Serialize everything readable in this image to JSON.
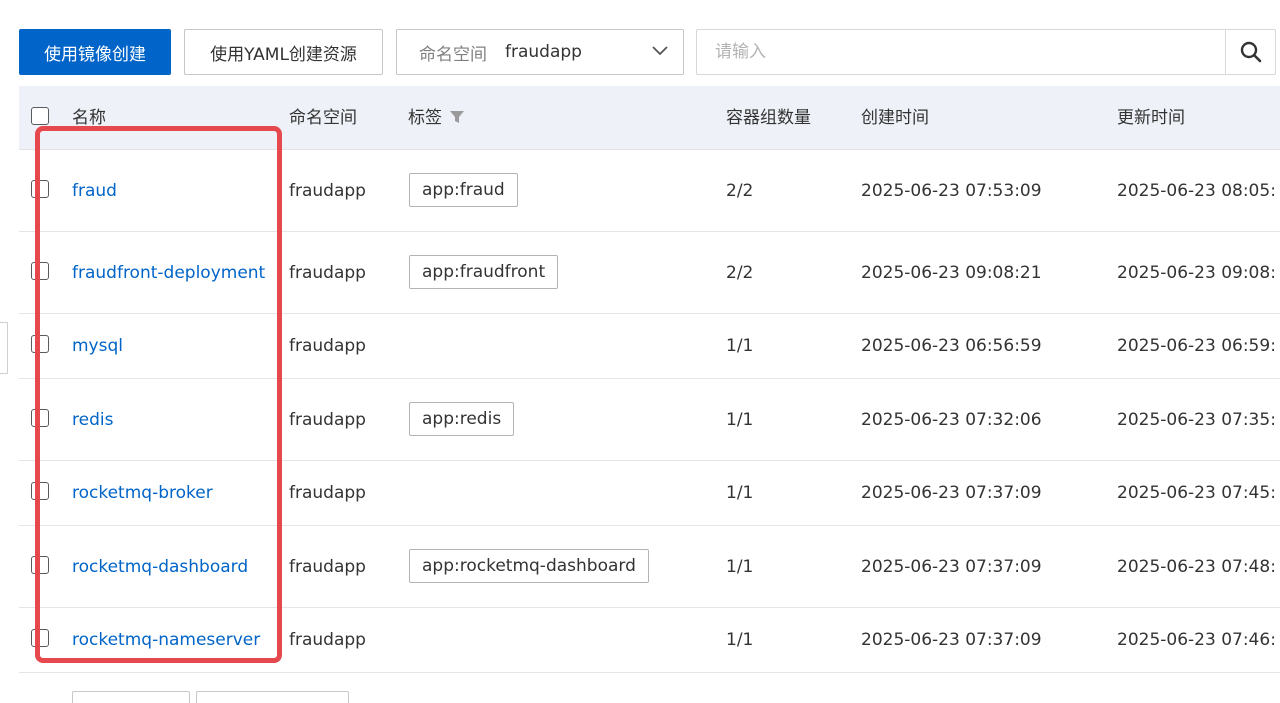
{
  "toolbar": {
    "create_image_label": "使用镜像创建",
    "create_yaml_label": "使用YAML创建资源",
    "namespace_label": "命名空间",
    "namespace_value": "fraudapp",
    "search_placeholder": "请输入"
  },
  "table": {
    "headers": {
      "name": "名称",
      "namespace": "命名空间",
      "labels": "标签",
      "pods": "容器组数量",
      "created": "创建时间",
      "updated": "更新时间"
    },
    "rows": [
      {
        "name": "fraud",
        "namespace": "fraudapp",
        "label": "app:fraud",
        "pods": "2/2",
        "created": "2025-06-23 07:53:09",
        "updated": "2025-06-23 08:05:"
      },
      {
        "name": "fraudfront-deployment",
        "namespace": "fraudapp",
        "label": "app:fraudfront",
        "pods": "2/2",
        "created": "2025-06-23 09:08:21",
        "updated": "2025-06-23 09:08:"
      },
      {
        "name": "mysql",
        "namespace": "fraudapp",
        "label": "",
        "pods": "1/1",
        "created": "2025-06-23 06:56:59",
        "updated": "2025-06-23 06:59:"
      },
      {
        "name": "redis",
        "namespace": "fraudapp",
        "label": "app:redis",
        "pods": "1/1",
        "created": "2025-06-23 07:32:06",
        "updated": "2025-06-23 07:35:"
      },
      {
        "name": "rocketmq-broker",
        "namespace": "fraudapp",
        "label": "",
        "pods": "1/1",
        "created": "2025-06-23 07:37:09",
        "updated": "2025-06-23 07:45:"
      },
      {
        "name": "rocketmq-dashboard",
        "namespace": "fraudapp",
        "label": "app:rocketmq-dashboard",
        "pods": "1/1",
        "created": "2025-06-23 07:37:09",
        "updated": "2025-06-23 07:48:"
      },
      {
        "name": "rocketmq-nameserver",
        "namespace": "fraudapp",
        "label": "",
        "pods": "1/1",
        "created": "2025-06-23 07:37:09",
        "updated": "2025-06-23 07:46:"
      }
    ]
  },
  "colors": {
    "primary": "#0064c8",
    "header_bg": "#eef2f8",
    "highlight": "#e5484d"
  },
  "icons": {
    "search": "search-icon",
    "chevron": "chevron-down-icon",
    "filter": "filter-icon"
  }
}
